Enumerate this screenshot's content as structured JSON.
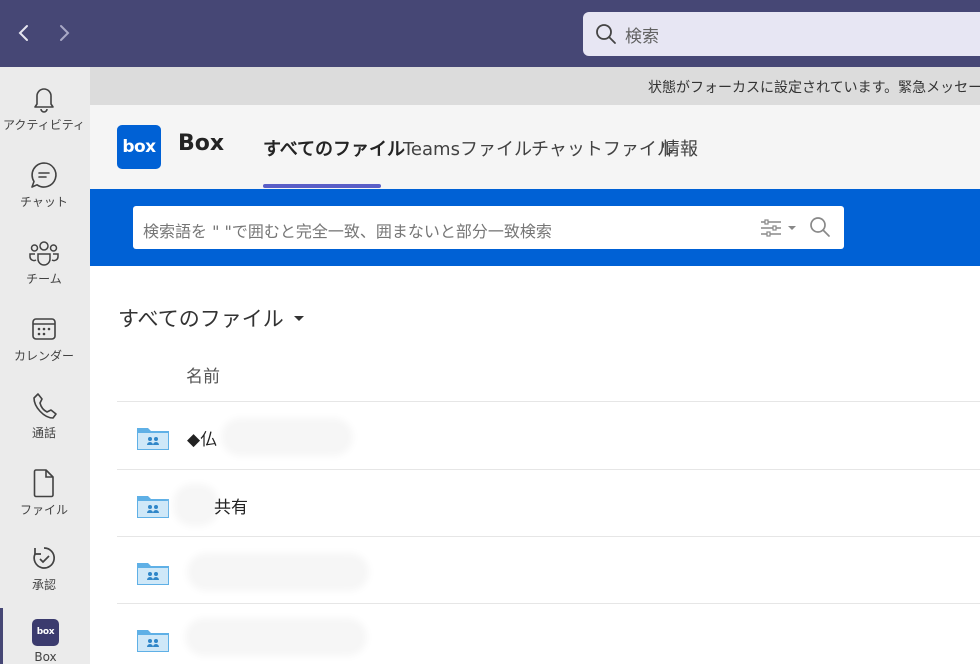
{
  "topbar": {
    "back_icon": "chevron-left-icon",
    "forward_icon": "chevron-right-icon",
    "search_placeholder": "検索"
  },
  "rail": {
    "items": [
      {
        "label": "アクティビティ",
        "icon": "bell-icon"
      },
      {
        "label": "チャット",
        "icon": "chat-icon"
      },
      {
        "label": "チーム",
        "icon": "teams-icon"
      },
      {
        "label": "カレンダー",
        "icon": "calendar-icon"
      },
      {
        "label": "通話",
        "icon": "phone-icon"
      },
      {
        "label": "ファイル",
        "icon": "file-icon"
      },
      {
        "label": "承認",
        "icon": "approvals-icon"
      },
      {
        "label": "Box",
        "icon": "box-app-icon",
        "logo_text": "box"
      }
    ]
  },
  "banner": {
    "text": "状態がフォーカスに設定されています。緊急メッセージ"
  },
  "app": {
    "logo_text": "box",
    "name": "Box",
    "tabs": [
      {
        "label": "すべてのファイル",
        "active": true
      },
      {
        "label": "Teamsファイル",
        "active": false
      },
      {
        "label": "チャットファイル",
        "active": false
      },
      {
        "label": "情報",
        "active": false
      }
    ],
    "accent": "#5b5fc7",
    "brand_blue": "#0061d5"
  },
  "box_search": {
    "placeholder": "検索語を \" \"で囲むと完全一致、囲まないと部分一致検索"
  },
  "content": {
    "folder_dropdown": "すべてのファイル",
    "column_name": "名前",
    "rows": [
      {
        "name": "◆仏"
      },
      {
        "name": "共有"
      },
      {
        "name": ""
      },
      {
        "name": ""
      }
    ]
  }
}
